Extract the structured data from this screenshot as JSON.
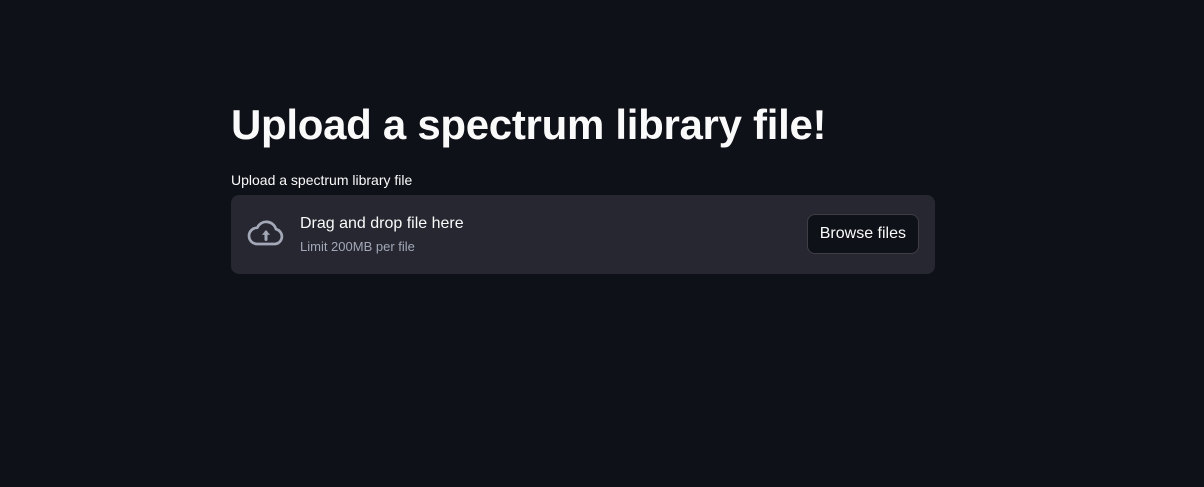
{
  "page": {
    "title": "Upload a spectrum library file!"
  },
  "uploader": {
    "label": "Upload a spectrum library file",
    "drop_text": "Drag and drop file here",
    "limit_text": "Limit 200MB per file",
    "browse_label": "Browse files",
    "icon": "cloud-upload-icon"
  },
  "colors": {
    "background": "#0e1117",
    "dropzone": "#262730",
    "text": "#fafafa",
    "muted_text": "#a3a8b8"
  }
}
